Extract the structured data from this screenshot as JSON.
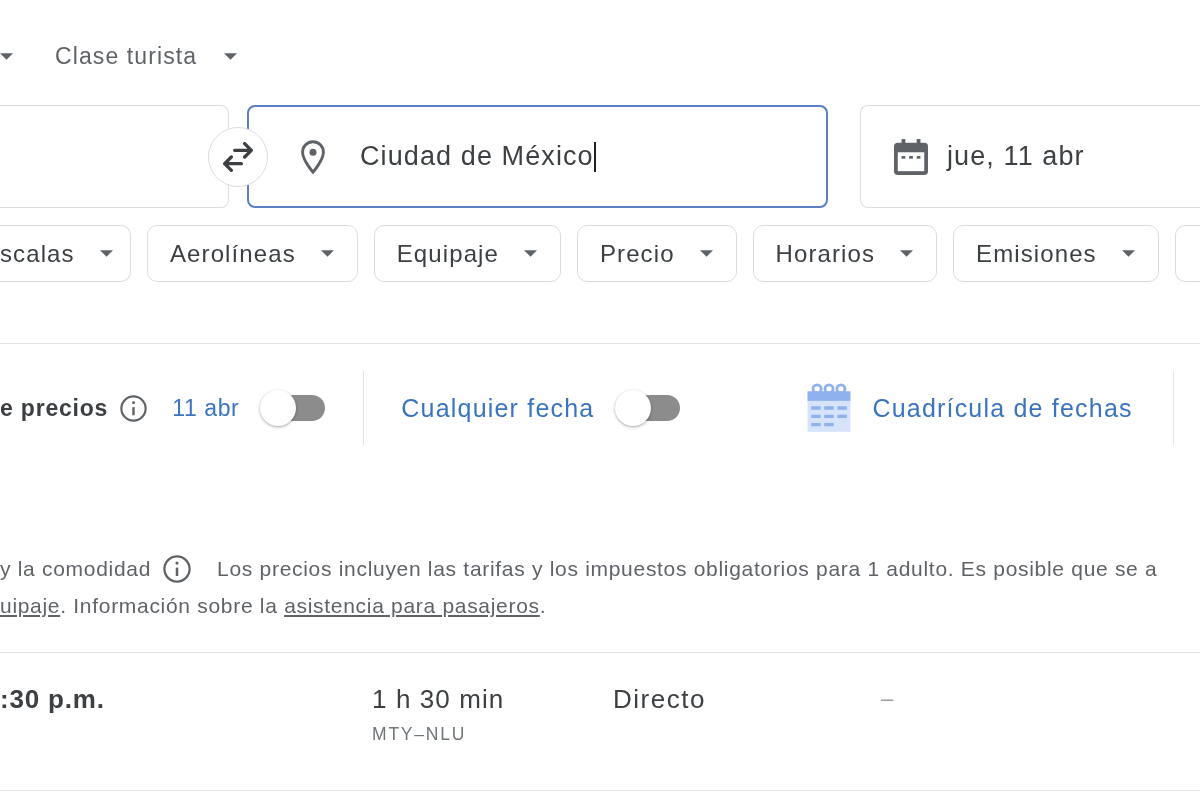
{
  "trip_options": {
    "cabin_class": "Clase turista"
  },
  "search": {
    "destination": {
      "value": "Ciudad de México",
      "focused": true
    },
    "departure_date": {
      "value": "jue, 11 abr"
    }
  },
  "filters": [
    {
      "label": "scalas"
    },
    {
      "label": "Aerolíneas"
    },
    {
      "label": "Equipaje"
    },
    {
      "label": "Precio"
    },
    {
      "label": "Horarios"
    },
    {
      "label": "Emisiones"
    }
  ],
  "date_tools": [
    {
      "kind": "toggle",
      "label": "e precios",
      "info": true,
      "date": "11 abr",
      "on": false
    },
    {
      "kind": "toggle",
      "label": "Cualquier fecha",
      "info": false,
      "on": false
    },
    {
      "kind": "grid_link",
      "label": "Cuadrícula de fechas"
    }
  ],
  "notice": {
    "intro": "y la comodidad",
    "info": true,
    "text": "Los precios incluyen las tarifas y los impuestos obligatorios para 1 adulto. Es posible que se a",
    "second_line": [
      {
        "kind": "link",
        "text": "uipaje"
      },
      {
        "kind": "text",
        "text": ". Información sobre la "
      },
      {
        "kind": "link",
        "text": "asistencia para pasajeros"
      },
      {
        "kind": "text",
        "text": "."
      }
    ]
  },
  "results": [
    {
      "times": ":30 p.m.",
      "duration": "1 h 30 min",
      "route": "MTY–NLU",
      "stops": "Directo",
      "column_5": "–"
    }
  ]
}
